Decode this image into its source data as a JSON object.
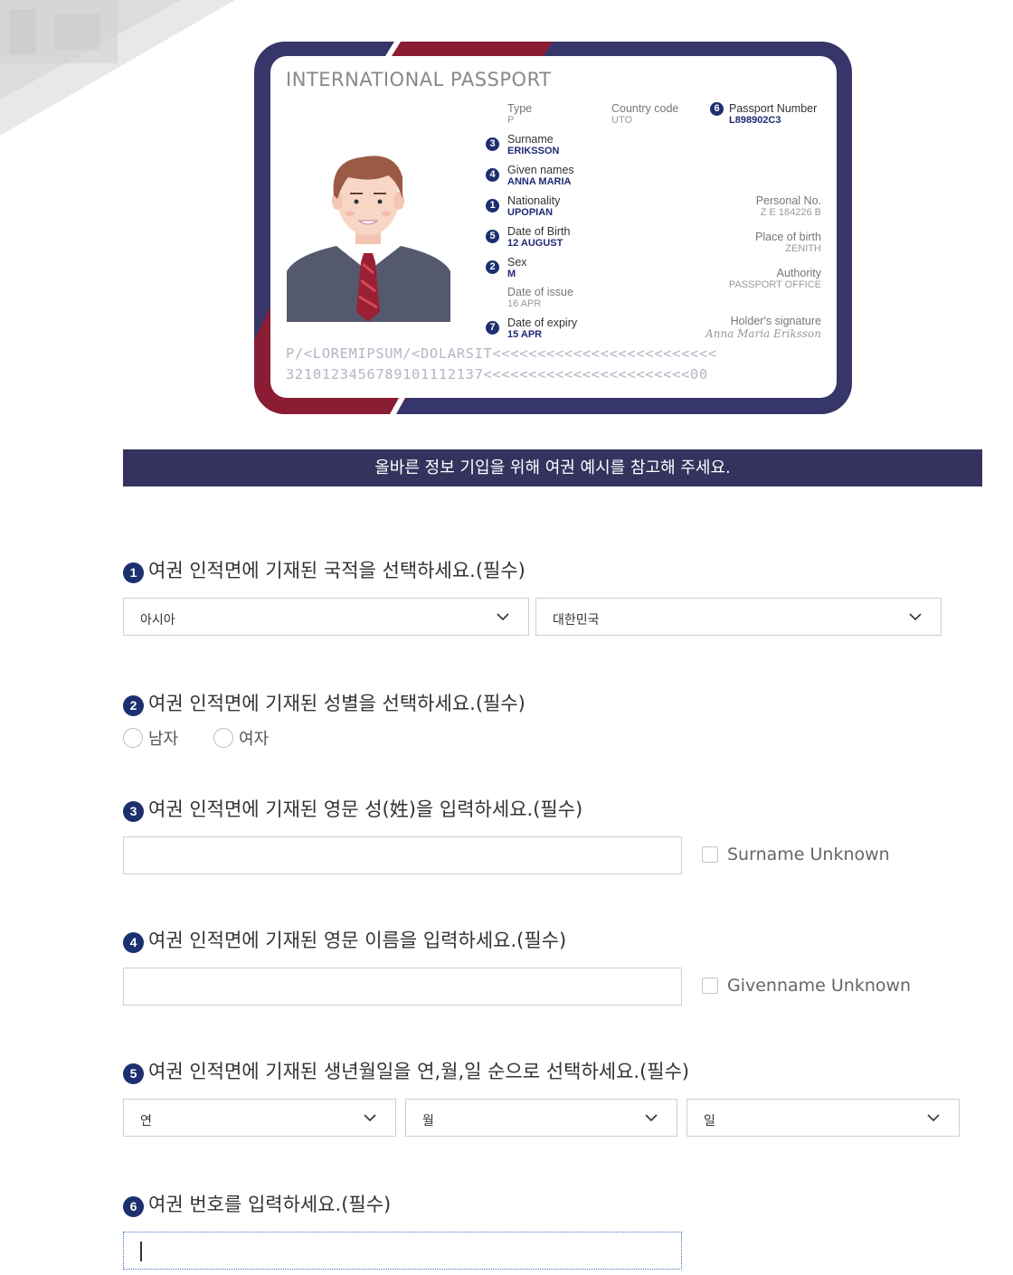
{
  "passport": {
    "title": "INTERNATIONAL PASSPORT",
    "type": {
      "label": "Type",
      "value": "P"
    },
    "country_code": {
      "label": "Country code",
      "value": "UTO"
    },
    "passport_number": {
      "num": "6",
      "label": "Passport Number",
      "value": "L898902C3"
    },
    "surname": {
      "num": "3",
      "label": "Surname",
      "value": "ERIKSSON"
    },
    "given_names": {
      "num": "4",
      "label": "Given names",
      "value": "ANNA MARIA"
    },
    "nationality": {
      "num": "1",
      "label": "Nationality",
      "value": "UPOPIAN"
    },
    "date_of_birth": {
      "num": "5",
      "label": "Date of Birth",
      "value": "12 AUGUST"
    },
    "sex": {
      "num": "2",
      "label": "Sex",
      "value": "M"
    },
    "date_of_issue": {
      "label": "Date of issue",
      "value": "16 APR"
    },
    "date_of_expiry": {
      "num": "7",
      "label": "Date of expiry",
      "value": "15 APR"
    },
    "personal_no": {
      "label": "Personal No.",
      "value": "Z E 184226 B"
    },
    "place_of_birth": {
      "label": "Place of birth",
      "value": "ZENITH"
    },
    "authority": {
      "label": "Authority",
      "value": "PASSPORT OFFICE"
    },
    "holder_signature": {
      "label": "Holder's signature",
      "value": "Anna Maria Eriksson"
    },
    "mrz_line1": "P/<LOREMIPSUM/<DOLARSIT<<<<<<<<<<<<<<<<<<<<<<<<<",
    "mrz_line2": "3210123456789101112137<<<<<<<<<<<<<<<<<<<<<<<00"
  },
  "notice": "올바른 정보 기입을 위해 여권 예시를 참고해 주세요.",
  "questions": {
    "q1": {
      "num": "1",
      "text": "여권 인적면에 기재된 국적을 선택하세요.(필수)",
      "region": "아시아",
      "country": "대한민국"
    },
    "q2": {
      "num": "2",
      "text": "여권 인적면에 기재된 성별을 선택하세요.(필수)",
      "options": [
        "남자",
        "여자"
      ]
    },
    "q3": {
      "num": "3",
      "text": "여권 인적면에 기재된 영문 성(姓)을 입력하세요.(필수)",
      "value": "",
      "unknown_label": "Surname Unknown"
    },
    "q4": {
      "num": "4",
      "text": "여권 인적면에 기재된 영문 이름을 입력하세요.(필수)",
      "value": "",
      "unknown_label": "Givenname Unknown"
    },
    "q5": {
      "num": "5",
      "text": "여권 인적면에 기재된 생년월일을 연,월,일 순으로 선택하세요.(필수)",
      "year": "연",
      "month": "월",
      "day": "일"
    },
    "q6": {
      "num": "6",
      "text": "여권 번호를 입력하세요.(필수)",
      "value": ""
    }
  },
  "colors": {
    "navy": "#33335e",
    "badge": "#1c2f6e",
    "red": "#8a1c33"
  }
}
